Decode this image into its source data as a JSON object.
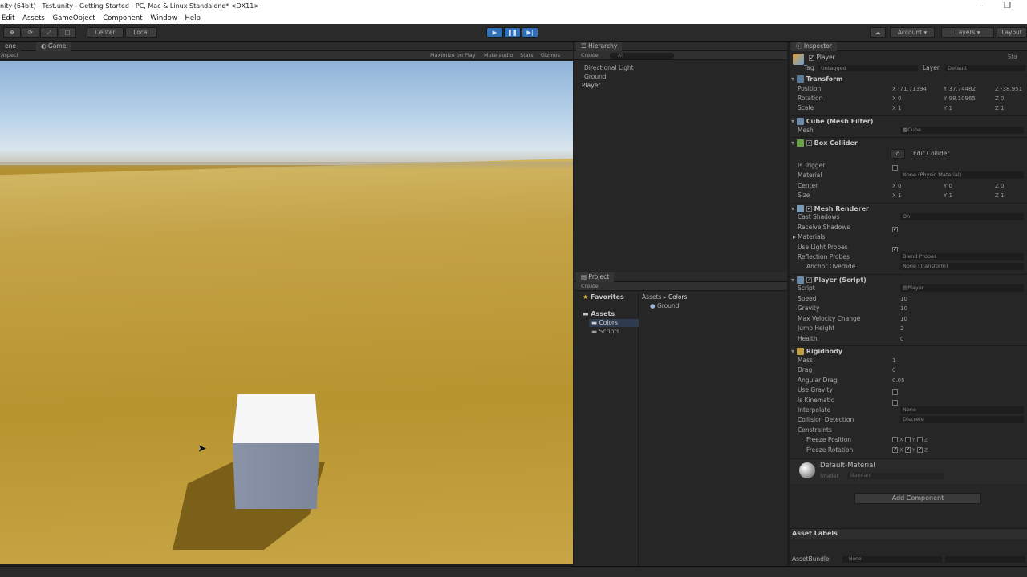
{
  "window": {
    "title": "nity (64bit) - Test.unity - Getting Started - PC, Mac & Linux Standalone* <DX11>",
    "minimize_glyph": "–",
    "restore_glyph": "❐"
  },
  "menu": [
    "Edit",
    "Assets",
    "GameObject",
    "Component",
    "Window",
    "Help"
  ],
  "toolbar": {
    "pivot_center": "Center",
    "pivot_local": "Local",
    "account": "Account",
    "layers": "Layers",
    "layout": "Layout"
  },
  "game": {
    "tab_scene": "ene",
    "tab_game": "Game",
    "aspect": "Aspect",
    "maximize": "Maximize on Play",
    "mute": "Mute audio",
    "stats": "Stats",
    "gizmos": "Gizmos"
  },
  "hierarchy": {
    "title": "Hierarchy",
    "create": "Create",
    "search_placeholder": "All",
    "items": [
      "Directional Light",
      "Ground",
      "Player"
    ]
  },
  "project": {
    "title": "Project",
    "create": "Create",
    "favorites": "Favorites",
    "assets": "Assets",
    "folders": [
      "Colors",
      "Scripts"
    ],
    "breadcrumb": [
      "Assets",
      "Colors"
    ],
    "files": [
      "Ground"
    ]
  },
  "inspector": {
    "title": "Inspector",
    "object_name": "Player",
    "static": "Sta",
    "tag_label": "Tag",
    "tag_value": "Untagged",
    "layer_label": "Layer",
    "layer_value": "Default",
    "transform": {
      "title": "Transform",
      "position": {
        "label": "Position",
        "x": "-71.71394",
        "y": "37.74482",
        "z": "-38.951"
      },
      "rotation": {
        "label": "Rotation",
        "x": "0",
        "y": "98.10965",
        "z": "0"
      },
      "scale": {
        "label": "Scale",
        "x": "1",
        "y": "1",
        "z": "1"
      }
    },
    "mesh_filter": {
      "title": "Cube (Mesh Filter)",
      "mesh_label": "Mesh",
      "mesh_value": "Cube"
    },
    "box_collider": {
      "title": "Box Collider",
      "edit": "Edit Collider",
      "is_trigger": "Is Trigger",
      "material_label": "Material",
      "material_value": "None (Physic Material)",
      "center": {
        "label": "Center",
        "x": "0",
        "y": "0",
        "z": "0"
      },
      "size": {
        "label": "Size",
        "x": "1",
        "y": "1",
        "z": "1"
      }
    },
    "mesh_renderer": {
      "title": "Mesh Renderer",
      "cast_shadows": "Cast Shadows",
      "cast_shadows_value": "On",
      "receive_shadows": "Receive Shadows",
      "materials": "Materials",
      "use_light_probes": "Use Light Probes",
      "reflection_probes": "Reflection Probes",
      "reflection_probes_value": "Blend Probes",
      "anchor_override": "Anchor Override",
      "anchor_override_value": "None (Transform)"
    },
    "player_script": {
      "title": "Player (Script)",
      "fields": [
        {
          "label": "Script",
          "value": "Player"
        },
        {
          "label": "Speed",
          "value": "10"
        },
        {
          "label": "Gravity",
          "value": "10"
        },
        {
          "label": "Max Velocity Change",
          "value": "10"
        },
        {
          "label": "Jump Height",
          "value": "2"
        },
        {
          "label": "Health",
          "value": "0"
        }
      ]
    },
    "rigidbody": {
      "title": "Rigidbody",
      "mass_label": "Mass",
      "mass": "1",
      "drag_label": "Drag",
      "drag": "0",
      "angular_drag_label": "Angular Drag",
      "angular_drag": "0.05",
      "use_gravity": "Use Gravity",
      "is_kinematic": "Is Kinematic",
      "interpolate_label": "Interpolate",
      "interpolate": "None",
      "collision_label": "Collision Detection",
      "collision": "Discrete",
      "constraints": "Constraints",
      "freeze_position": "Freeze Position",
      "freeze_rotation": "Freeze Rotation",
      "x": "X",
      "y": "Y",
      "z": "Z"
    },
    "material": {
      "name": "Default-Material",
      "shader_label": "Shader",
      "shader_value": "Standard"
    },
    "add_component": "Add Component",
    "asset_labels": "Asset Labels",
    "asset_bundle": "AssetBundle",
    "asset_bundle_value": "None"
  }
}
